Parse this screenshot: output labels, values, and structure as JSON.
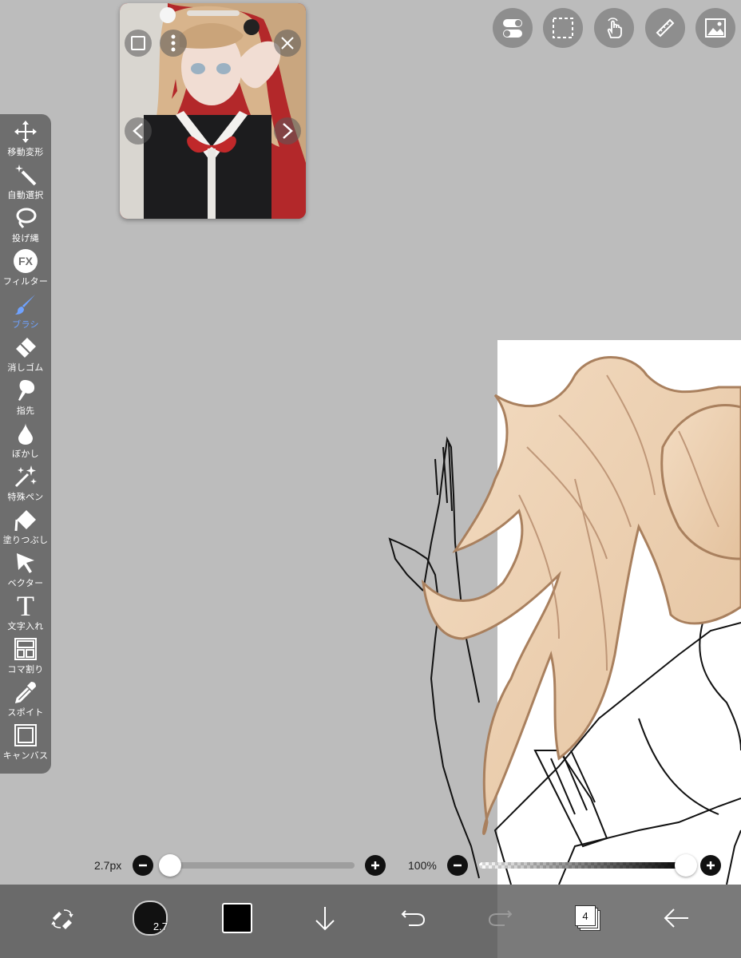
{
  "tools": [
    {
      "name": "move-transform",
      "label": "移動変形",
      "icon": "move-arrows-icon"
    },
    {
      "name": "magic-wand",
      "label": "自動選択",
      "icon": "magic-wand-icon"
    },
    {
      "name": "lasso",
      "label": "投げ縄",
      "icon": "lasso-icon"
    },
    {
      "name": "filter",
      "label": "フィルター",
      "icon": "fx-icon",
      "icon_text": "FX"
    },
    {
      "name": "brush",
      "label": "ブラシ",
      "icon": "brush-icon",
      "active": true
    },
    {
      "name": "eraser",
      "label": "消しゴム",
      "icon": "eraser-icon"
    },
    {
      "name": "smudge",
      "label": "指先",
      "icon": "smudge-icon"
    },
    {
      "name": "blur",
      "label": "ぼかし",
      "icon": "blur-drop-icon"
    },
    {
      "name": "special-pen",
      "label": "特殊ペン",
      "icon": "sparkle-pen-icon"
    },
    {
      "name": "fill",
      "label": "塗りつぶし",
      "icon": "fill-bucket-icon"
    },
    {
      "name": "vector",
      "label": "ベクター",
      "icon": "vector-cursor-icon"
    },
    {
      "name": "text",
      "label": "文字入れ",
      "icon": "text-icon",
      "icon_text": "T"
    },
    {
      "name": "frame-divider",
      "label": "コマ割り",
      "icon": "frame-divider-icon"
    },
    {
      "name": "eyedropper",
      "label": "スポイト",
      "icon": "eyedropper-icon"
    },
    {
      "name": "canvas",
      "label": "キャンバス",
      "icon": "canvas-icon"
    }
  ],
  "top_buttons": [
    "toggle-icon",
    "selection-icon",
    "touch-gesture-icon",
    "ruler-icon",
    "image-icon"
  ],
  "brush_size": {
    "label": "2.7px",
    "value": 2.7
  },
  "opacity": {
    "label": "100%",
    "value": 100
  },
  "color_button": {
    "size_text": "2.7"
  },
  "primary_color": "#000000",
  "layers": {
    "count": "4"
  },
  "accent_color": "#6fa2ff"
}
